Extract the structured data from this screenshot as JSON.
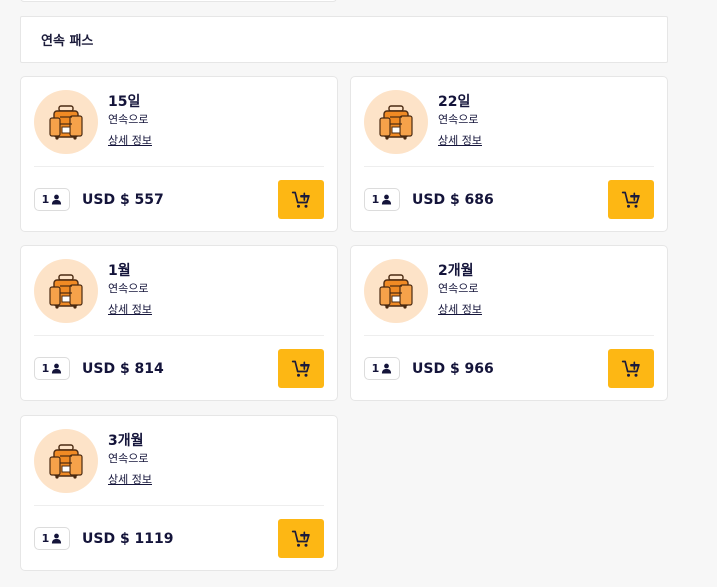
{
  "section": {
    "title": "연속 패스"
  },
  "passes": [
    {
      "title": "15일",
      "subtitle": "연속으로",
      "details_link": "상세 정보",
      "pax": "1",
      "price": "USD $ 557"
    },
    {
      "title": "22일",
      "subtitle": "연속으로",
      "details_link": "상세 정보",
      "pax": "1",
      "price": "USD $ 686"
    },
    {
      "title": "1월",
      "subtitle": "연속으로",
      "details_link": "상세 정보",
      "pax": "1",
      "price": "USD $ 814"
    },
    {
      "title": "2개월",
      "subtitle": "연속으로",
      "details_link": "상세 정보",
      "pax": "1",
      "price": "USD $ 966"
    },
    {
      "title": "3개월",
      "subtitle": "연속으로",
      "details_link": "상세 정보",
      "pax": "1",
      "price": "USD $ 1119"
    }
  ],
  "icons": {
    "pass_icon": "luggage-icon",
    "pax_icon": "person-icon",
    "cart_icon": "add-to-cart-icon"
  },
  "colors": {
    "accent": "#fdb714",
    "icon_bg": "#fde3c8",
    "luggage": "#f08a24",
    "text": "#14143a"
  }
}
